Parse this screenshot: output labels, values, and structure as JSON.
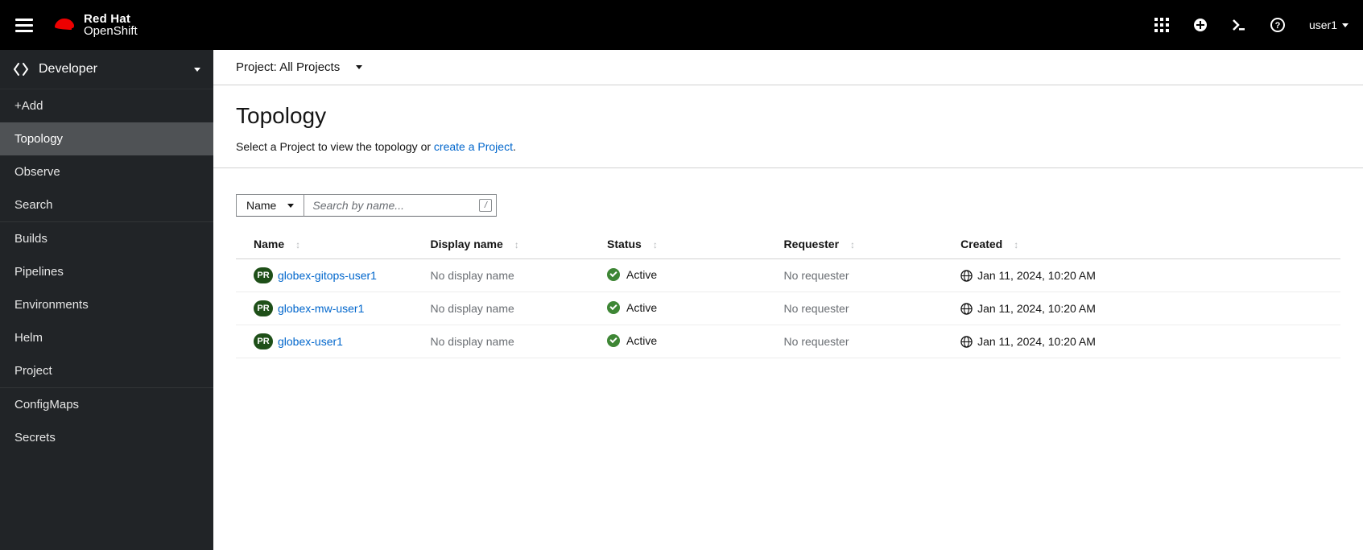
{
  "masthead": {
    "brand_top": "Red Hat",
    "brand_bot": "OpenShift",
    "user": "user1"
  },
  "perspective": {
    "label": "Developer"
  },
  "nav": {
    "groups": [
      {
        "items": [
          "+Add",
          "Topology",
          "Observe",
          "Search"
        ],
        "active": "Topology"
      },
      {
        "items": [
          "Builds",
          "Pipelines",
          "Environments",
          "Helm",
          "Project"
        ]
      },
      {
        "items": [
          "ConfigMaps",
          "Secrets"
        ]
      }
    ]
  },
  "project_bar": {
    "label_prefix": "Project:",
    "value": "All Projects"
  },
  "page": {
    "title": "Topology",
    "desc_pre": "Select a Project to view the topology or ",
    "desc_link": "create a Project",
    "desc_post": "."
  },
  "filter": {
    "dropdown": "Name",
    "placeholder": "Search by name...",
    "key": "/"
  },
  "table": {
    "cols": [
      "Name",
      "Display name",
      "Status",
      "Requester",
      "Created"
    ],
    "badge": "PR",
    "rows": [
      {
        "name": "globex-gitops-user1",
        "display": "No display name",
        "status": "Active",
        "requester": "No requester",
        "created": "Jan 11, 2024, 10:20 AM"
      },
      {
        "name": "globex-mw-user1",
        "display": "No display name",
        "status": "Active",
        "requester": "No requester",
        "created": "Jan 11, 2024, 10:20 AM"
      },
      {
        "name": "globex-user1",
        "display": "No display name",
        "status": "Active",
        "requester": "No requester",
        "created": "Jan 11, 2024, 10:20 AM"
      }
    ]
  }
}
